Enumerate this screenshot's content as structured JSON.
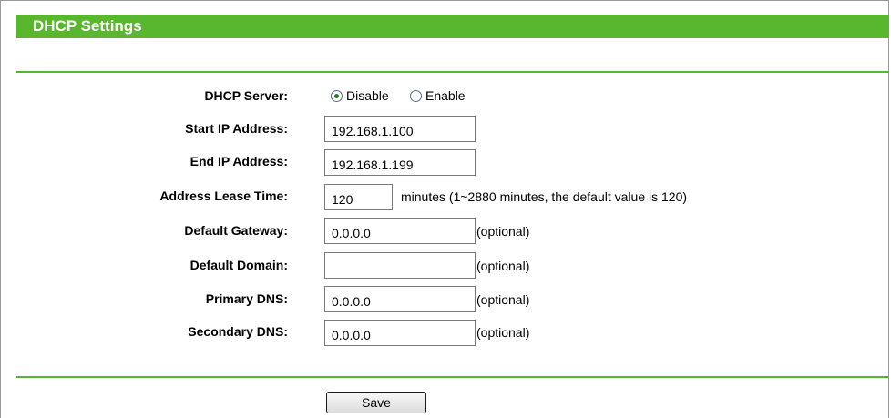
{
  "header": {
    "title": "DHCP Settings"
  },
  "dhcp_server": {
    "label": "DHCP Server:",
    "options": [
      {
        "label": "Disable",
        "selected": true
      },
      {
        "label": "Enable",
        "selected": false
      }
    ]
  },
  "start_ip": {
    "label": "Start IP Address:",
    "value": "192.168.1.100"
  },
  "end_ip": {
    "label": "End IP Address:",
    "value": "192.168.1.199"
  },
  "lease_time": {
    "label": "Address Lease Time:",
    "value": "120",
    "note": "minutes (1~2880 minutes, the default value is 120)"
  },
  "gateway": {
    "label": "Default Gateway:",
    "value": "0.0.0.0",
    "note": "(optional)"
  },
  "domain": {
    "label": "Default Domain:",
    "value": "",
    "note": "(optional)"
  },
  "primary_dns": {
    "label": "Primary DNS:",
    "value": "0.0.0.0",
    "note": "(optional)"
  },
  "secondary_dns": {
    "label": "Secondary DNS:",
    "value": "0.0.0.0",
    "note": "(optional)"
  },
  "actions": {
    "save_label": "Save"
  },
  "colors": {
    "accent": "#59b72f"
  }
}
